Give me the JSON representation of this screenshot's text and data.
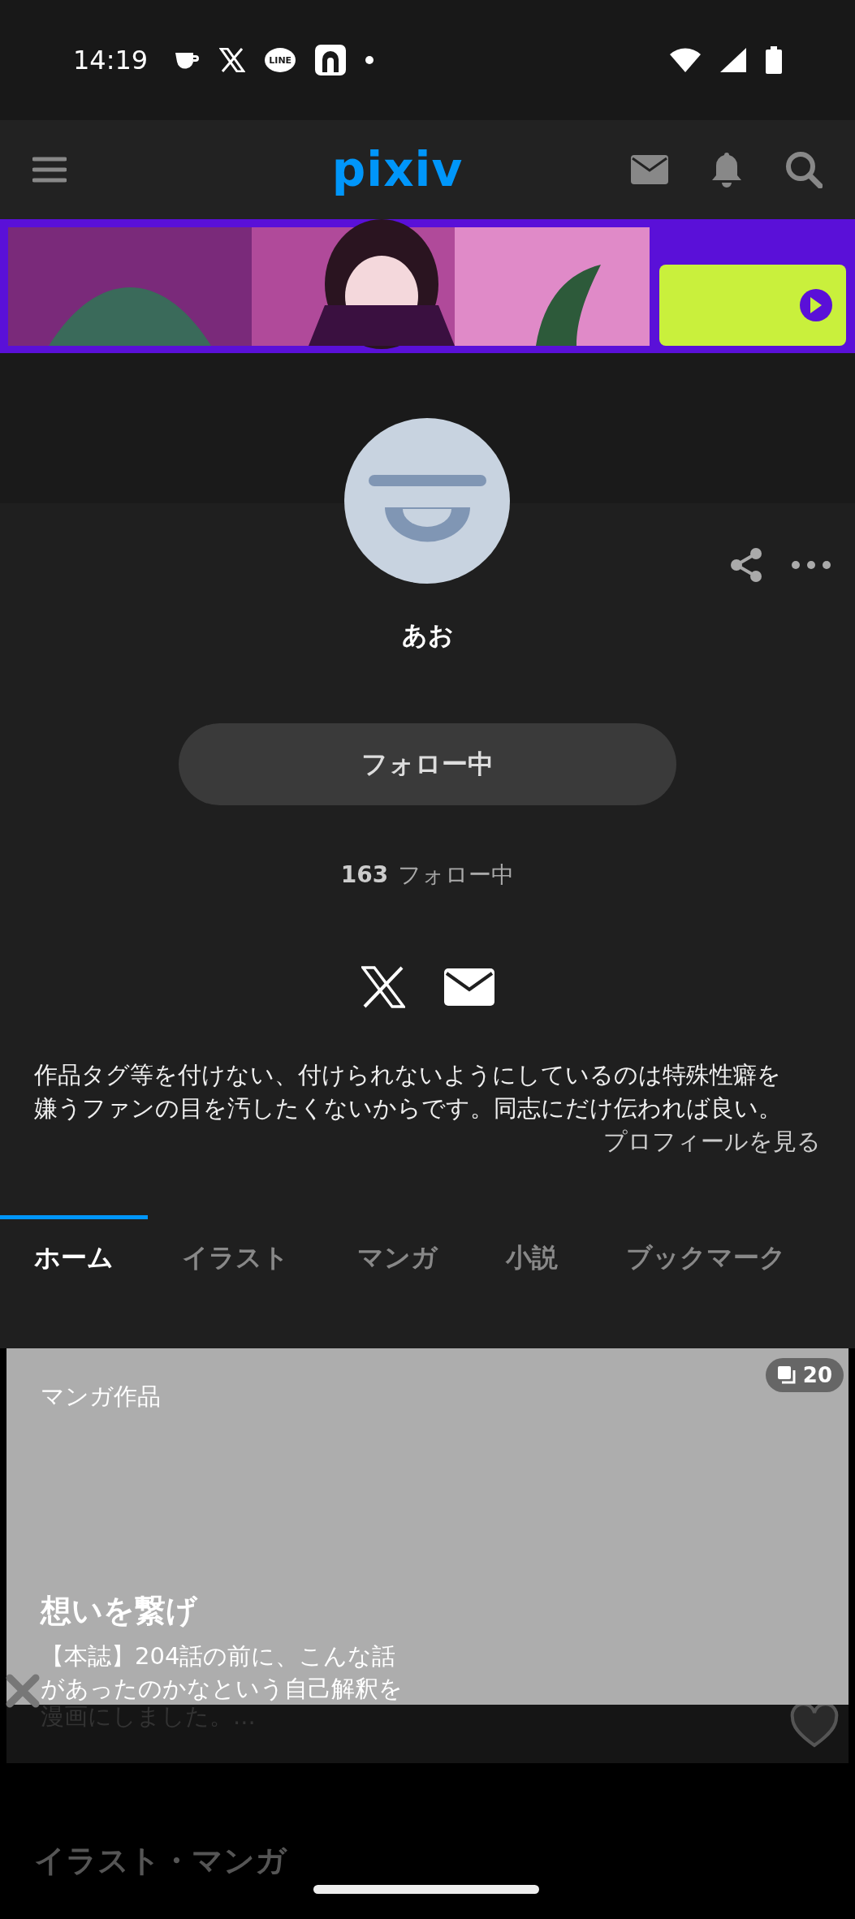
{
  "status_bar": {
    "time": "14:19",
    "line_badge": "LINE"
  },
  "header": {
    "logo": "pixiv"
  },
  "profile": {
    "name": "あお",
    "follow_button": "フォロー中",
    "following_count": "163",
    "following_label": "フォロー中",
    "bio": "作品タグ等を付けない、付けられないようにしているのは特殊性癖を嫌うファンの目を汚したくないからです。同志にだけ伝われば良い。",
    "profile_link": "プロフィールを見る"
  },
  "tabs": [
    {
      "label": "ホーム",
      "selected": true
    },
    {
      "label": "イラスト",
      "selected": false
    },
    {
      "label": "マンガ",
      "selected": false
    },
    {
      "label": "小説",
      "selected": false
    },
    {
      "label": "ブックマーク",
      "selected": false
    }
  ],
  "card": {
    "category": "マンガ作品",
    "page_count": "20",
    "title": "想いを繋げ",
    "description_lines": [
      "【本誌】204話の前に、こんな話",
      "があったのかなという自己解釈を"
    ],
    "description_faded": "漫画にしました。..."
  },
  "next_section": {
    "heading": "イラスト・マンガ"
  }
}
